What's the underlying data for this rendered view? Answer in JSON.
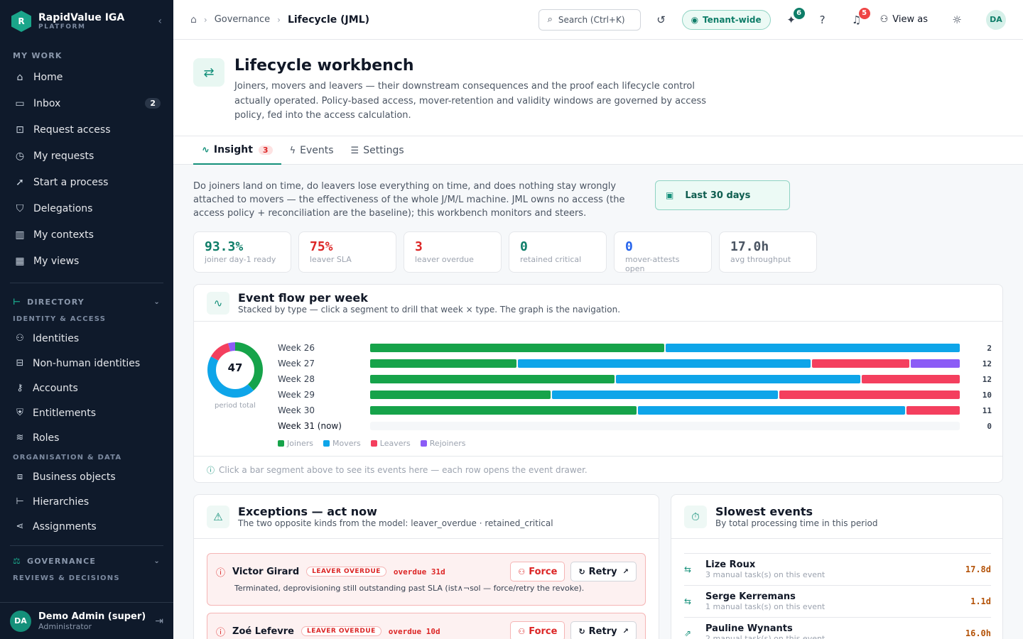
{
  "brand": {
    "name": "RapidValue IGA",
    "sub": "PLATFORM",
    "logo": "R"
  },
  "sidebar": {
    "my_work_label": "MY WORK",
    "items": [
      {
        "label": "Home",
        "icon": "home-icon",
        "glyph": "⌂"
      },
      {
        "label": "Inbox",
        "icon": "inbox-icon",
        "glyph": "▭",
        "badge": "2"
      },
      {
        "label": "Request access",
        "icon": "cart-icon",
        "glyph": "⊡"
      },
      {
        "label": "My requests",
        "icon": "requests-icon",
        "glyph": "◷"
      },
      {
        "label": "Start a process",
        "icon": "rocket-icon",
        "glyph": "➚"
      },
      {
        "label": "Delegations",
        "icon": "delegation-icon",
        "glyph": "⛉"
      },
      {
        "label": "My contexts",
        "icon": "building-icon",
        "glyph": "▥"
      },
      {
        "label": "My views",
        "icon": "grid-icon",
        "glyph": "▦"
      }
    ],
    "directory": {
      "label": "DIRECTORY",
      "sub1": "IDENTITY & ACCESS",
      "items1": [
        {
          "label": "Identities",
          "icon": "user-icon",
          "glyph": "⚇"
        },
        {
          "label": "Non-human identities",
          "icon": "bot-icon",
          "glyph": "⊟"
        },
        {
          "label": "Accounts",
          "icon": "key-icon",
          "glyph": "⚷"
        },
        {
          "label": "Entitlements",
          "icon": "shield-icon",
          "glyph": "⛨"
        },
        {
          "label": "Roles",
          "icon": "layers-icon",
          "glyph": "≋"
        }
      ],
      "sub2": "ORGANISATION & DATA",
      "items2": [
        {
          "label": "Business objects",
          "icon": "box-icon",
          "glyph": "⧈"
        },
        {
          "label": "Hierarchies",
          "icon": "tree-icon",
          "glyph": "⊢"
        },
        {
          "label": "Assignments",
          "icon": "share-icon",
          "glyph": "⋖"
        }
      ]
    },
    "governance": {
      "label": "GOVERNANCE",
      "sub": "REVIEWS & DECISIONS"
    }
  },
  "user": {
    "initials": "DA",
    "name": "Demo Admin (super)",
    "role": "Administrator"
  },
  "topbar": {
    "crumb1": "Governance",
    "crumb2": "Lifecycle (JML)",
    "search_placeholder": "Search (Ctrl+K)",
    "tenant": "Tenant-wide",
    "pin_badge": "6",
    "notif_badge": "5",
    "view_as": "View as",
    "initials": "DA"
  },
  "page": {
    "title": "Lifecycle workbench",
    "desc": "Joiners, movers and leavers — their downstream consequences and the proof each lifecycle control actually operated. Policy-based access, mover-retention and validity windows are governed by access policy, fed into the access calculation."
  },
  "tabs": [
    {
      "label": "Insight",
      "badge": "3",
      "glyph": "∿"
    },
    {
      "label": "Events",
      "glyph": "ϟ"
    },
    {
      "label": "Settings",
      "glyph": "☰"
    }
  ],
  "intro": "Do joiners land on time, do leavers lose everything on time, and does nothing stay wrongly attached to movers — the effectiveness of the whole J/M/L machine. JML owns no access (the access policy + reconciliation are the baseline); this workbench monitors and steers.",
  "period": "Last 30 days",
  "kpis": [
    {
      "value": "93.3%",
      "label": "joiner day-1 ready",
      "color": "#0e7d68"
    },
    {
      "value": "75%",
      "label": "leaver SLA",
      "color": "#dc2626"
    },
    {
      "value": "3",
      "label": "leaver overdue",
      "color": "#dc2626"
    },
    {
      "value": "0",
      "label": "retained critical",
      "color": "#0e7d68"
    },
    {
      "value": "0",
      "label": "mover-attests open",
      "color": "#2563eb"
    },
    {
      "value": "17.0h",
      "label": "avg throughput",
      "color": "#4b5563"
    }
  ],
  "flow": {
    "title": "Event flow per week",
    "sub": "Stacked by type — click a segment to drill that week × type. The graph is the navigation.",
    "footer": "Click a bar segment above to see its events here — each row opens the event drawer."
  },
  "chart_data": {
    "type": "bar",
    "stacked": true,
    "orientation": "horizontal",
    "categories": [
      "Week 26",
      "Week 27",
      "Week 28",
      "Week 29",
      "Week 30",
      "Week 31 (now)"
    ],
    "series": [
      {
        "name": "Joiners",
        "color": "#16a34a",
        "values": [
          1,
          3,
          5,
          4,
          5,
          0
        ]
      },
      {
        "name": "Movers",
        "color": "#0ea5e9",
        "values": [
          1,
          6,
          5,
          5,
          5,
          0
        ]
      },
      {
        "name": "Leavers",
        "color": "#f43f5e",
        "values": [
          0,
          2,
          2,
          4,
          1,
          0
        ]
      },
      {
        "name": "Rejoiners",
        "color": "#8b5cf6",
        "values": [
          0,
          1,
          0,
          0,
          0,
          0
        ]
      }
    ],
    "totals": [
      "2",
      "12",
      "12",
      "10",
      "11",
      "0"
    ],
    "donut": {
      "total": "47",
      "label": "period total",
      "values": [
        18,
        21,
        6,
        2
      ]
    }
  },
  "exceptions": {
    "title": "Exceptions — act now",
    "sub": "The two opposite kinds from the model: leaver_overdue · retained_critical",
    "items": [
      {
        "name": "Victor Girard",
        "tag": "LEAVER OVERDUE",
        "overdue": "overdue 31d",
        "desc": "Terminated, deprovisioning still outstanding past SLA (ist∧¬sol — force/retry the revoke).",
        "force": "Force",
        "retry": "Retry"
      },
      {
        "name": "Zoé Lefevre",
        "tag": "LEAVER OVERDUE",
        "overdue": "overdue 10d",
        "force": "Force",
        "retry": "Retry"
      }
    ]
  },
  "slowest": {
    "title": "Slowest events",
    "sub": "By total processing time in this period",
    "items": [
      {
        "name": "Lize Roux",
        "sub": "3 manual task(s) on this event",
        "value": "17.8d",
        "glyph": "⇆"
      },
      {
        "name": "Serge Kerremans",
        "sub": "1 manual task(s) on this event",
        "value": "1.1d",
        "glyph": "⇆"
      },
      {
        "name": "Pauline Wynants",
        "sub": "2 manual task(s) on this event",
        "value": "16.0h",
        "glyph": "⇗"
      }
    ]
  }
}
